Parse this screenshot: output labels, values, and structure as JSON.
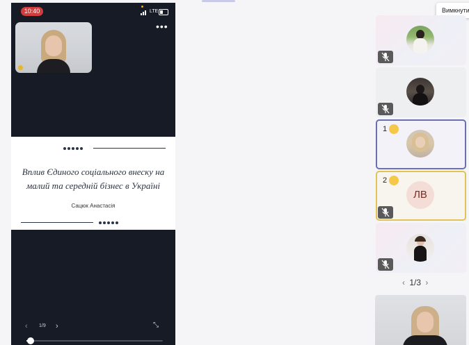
{
  "status_bar": {
    "time": "10:40",
    "network": "LTE"
  },
  "slide": {
    "title_line1": "Вплив Єдиного соціального внеску на",
    "title_line2": "малий та середній бізнес в Україні",
    "author": "Сацюк Анастасія"
  },
  "share_controls": {
    "page_indicator": "1/9",
    "progress_fraction": 0.03
  },
  "tooltip": {
    "text": "Вимкнути"
  },
  "participants": {
    "tiles": [
      {
        "id": "p1",
        "avatar": "photo",
        "muted": true
      },
      {
        "id": "p2",
        "avatar": "photo",
        "muted": true
      },
      {
        "id": "p3",
        "avatar": "photo",
        "muted": false,
        "hand_order": "1"
      },
      {
        "id": "p4",
        "avatar": "initials",
        "initials": "ЛВ",
        "muted": true,
        "hand_order": "2"
      },
      {
        "id": "p5",
        "avatar": "photo",
        "muted": true
      }
    ],
    "pager": "1/3"
  },
  "colors": {
    "hand_border": "#6a6fb0",
    "gold_border": "#e0c355",
    "recording": "#d13c3c"
  }
}
